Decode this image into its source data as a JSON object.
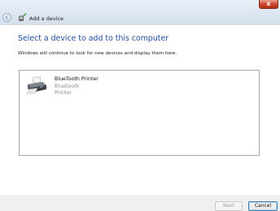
{
  "window": {
    "title": "Add a device",
    "close_glyph": "x"
  },
  "main": {
    "heading": "Select a device to add to this computer",
    "subtext": "Windows will continue to look for new devices and display them here."
  },
  "devices": [
    {
      "name": "BlueTooth Printer",
      "type": "Bluetooth",
      "category": "Printer",
      "icon": "printer-icon"
    }
  ],
  "buttons": {
    "next_label": "Next",
    "cancel_label": "Cancel"
  },
  "icons": {
    "back": "back-arrow-icon",
    "wizard": "add-device-wizard-icon",
    "close": "close-icon"
  },
  "colors": {
    "heading": "#1f4e9c",
    "titlebar": "#dde7f2",
    "footer": "#f0f0f0",
    "close_button": "#c9442a",
    "disabled_text": "#a0a0a0"
  }
}
